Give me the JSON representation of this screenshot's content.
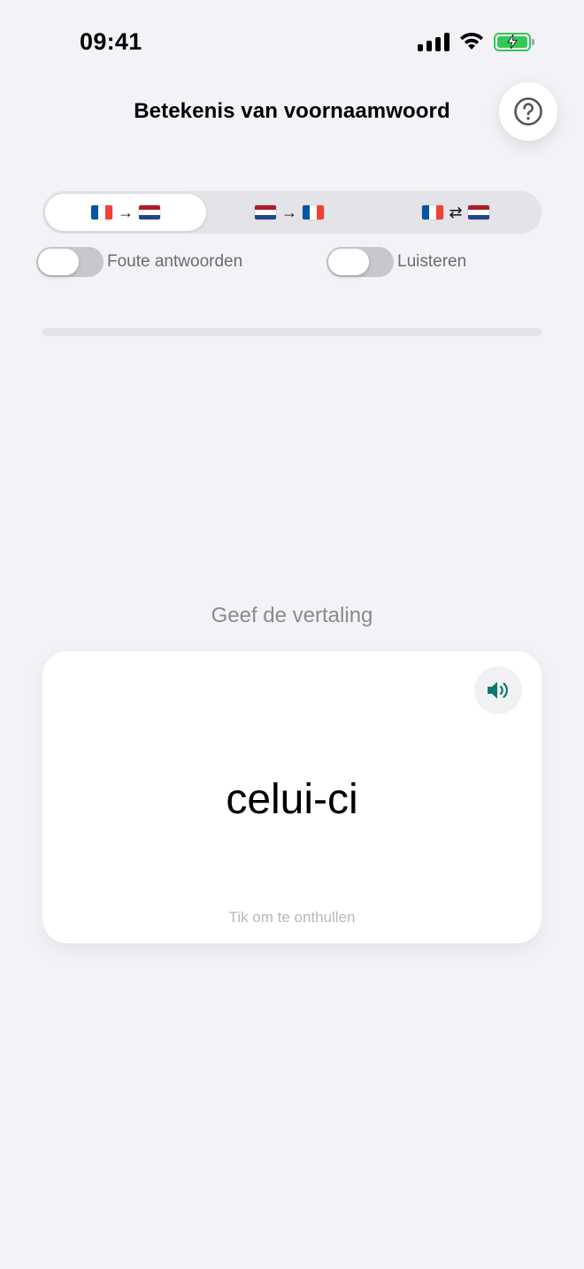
{
  "status_bar": {
    "time": "09:41",
    "icons": [
      "cellular-signal-icon",
      "wifi-icon",
      "battery-charging-icon"
    ],
    "battery_color": "#34c759"
  },
  "header": {
    "title": "Betekenis van voornaamwoord",
    "help_icon": "question-mark-icon"
  },
  "direction_tabs": [
    {
      "from": "fr",
      "to": "nl",
      "arrow": "→",
      "active": true
    },
    {
      "from": "nl",
      "to": "fr",
      "arrow": "→",
      "active": false
    },
    {
      "from": "fr",
      "to": "nl",
      "arrow": "⇄",
      "active": false
    }
  ],
  "toggles": {
    "wrong_answers": {
      "label": "Foute antwoorden",
      "on": false
    },
    "listen": {
      "label": "Luisteren",
      "on": false
    }
  },
  "progress": {
    "fraction": 0
  },
  "prompt": "Geef de vertaling",
  "card": {
    "word": "celui-ci",
    "hint": "Tik om te onthullen",
    "speaker_icon": "speaker-icon"
  },
  "colors": {
    "background": "#f2f2f7",
    "accent": "#0a7a6a"
  }
}
